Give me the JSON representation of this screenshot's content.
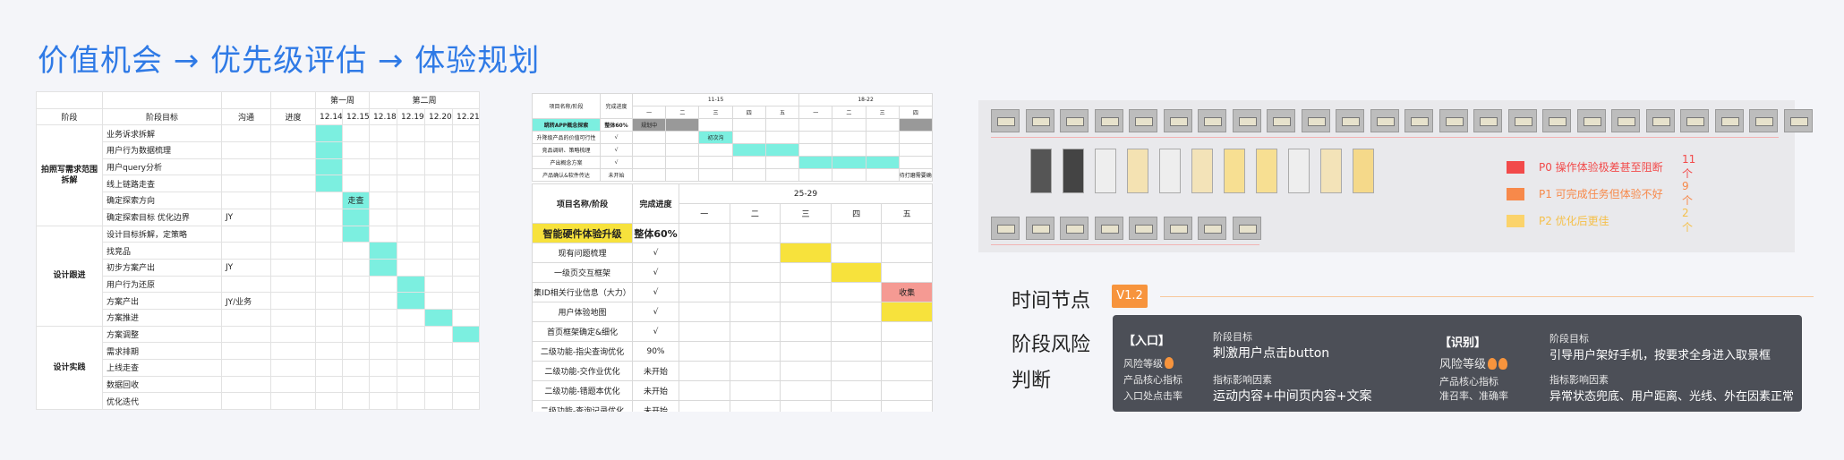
{
  "title": "价值机会 → 优先级评估 → 体验规划",
  "gantt1": {
    "week1": "第一周",
    "week2": "第二周",
    "headers": [
      "阶段",
      "阶段目标",
      "沟通",
      "进度",
      "12.14",
      "12.15",
      "12.18",
      "12.19",
      "12.20",
      "12.21"
    ],
    "phases": [
      "拍照写需求范围拆解",
      "设计跟进",
      "设计实践"
    ],
    "rows": [
      {
        "goal": "业务诉求拆解",
        "comm": ""
      },
      {
        "goal": "用户行为数据梳理",
        "comm": ""
      },
      {
        "goal": "用户query分析",
        "comm": ""
      },
      {
        "goal": "线上链路走查",
        "comm": ""
      },
      {
        "goal": "确定探索方向",
        "comm": ""
      },
      {
        "goal": "确定探索目标 优化边界",
        "comm": "JY"
      },
      {
        "goal": "设计目标拆解，定策略",
        "comm": ""
      },
      {
        "goal": "找竞品",
        "comm": ""
      },
      {
        "goal": "初步方案产出",
        "comm": "JY"
      },
      {
        "goal": "用户行为还原",
        "comm": ""
      },
      {
        "goal": "方案产出",
        "comm": "JY/业务"
      },
      {
        "goal": "方案推进",
        "comm": ""
      },
      {
        "goal": "方案调整",
        "comm": ""
      },
      {
        "goal": "需求排期",
        "comm": ""
      },
      {
        "goal": "上线走查",
        "comm": ""
      },
      {
        "goal": "数据回收",
        "comm": ""
      },
      {
        "goal": "优化迭代",
        "comm": ""
      }
    ],
    "walk_label": "走查"
  },
  "gantt2": {
    "mini": {
      "h1": "项目名称/阶段",
      "h2": "完成进度",
      "w1": "11-15",
      "w2": "18-22",
      "days": [
        "一",
        "二",
        "三",
        "四",
        "五",
        "一",
        "二",
        "三",
        "四"
      ],
      "rows": [
        {
          "name": "跳转APP概念探索",
          "prog": "整体60%"
        },
        {
          "name": "升降级产品的价值可行性",
          "prog": "√"
        },
        {
          "name": "竞品调研、策略梳理",
          "prog": "√"
        },
        {
          "name": "产出概念方案",
          "prog": "√"
        },
        {
          "name": "产品确认&软件传达",
          "prog": "未开始"
        }
      ],
      "tag1": "规划中",
      "tag2": "初次沟",
      "note": "待打磨需要确认"
    },
    "main": {
      "h1": "项目名称/阶段",
      "h2": "完成进度",
      "week": "25-29",
      "days": [
        "一",
        "二",
        "三",
        "四",
        "五"
      ],
      "rows": [
        {
          "name": "智能硬件体验升级",
          "prog": "整体60%"
        },
        {
          "name": "现有问题梳理",
          "prog": "√"
        },
        {
          "name": "一级页交互框架",
          "prog": "√"
        },
        {
          "name": "集ID相关行业信息（大力）",
          "prog": "√"
        },
        {
          "name": "用户体验地图",
          "prog": "√"
        },
        {
          "name": "首页框架确定&细化",
          "prog": "√"
        },
        {
          "name": "二级功能-指尖查询优化",
          "prog": "90%"
        },
        {
          "name": "二级功能-交作业优化",
          "prog": "未开始"
        },
        {
          "name": "二级功能-错题本优化",
          "prog": "未开始"
        },
        {
          "name": "二级功能-查询记录优化",
          "prog": "未开始"
        }
      ],
      "collect": "收集"
    }
  },
  "legend": [
    {
      "label": "P0 操作体验极差甚至阻断",
      "count": "11个",
      "color": "#f24a4a"
    },
    {
      "label": "P1 可完成任务但体验不好",
      "count": "9个",
      "color": "#f7894a"
    },
    {
      "label": "P2 优化后更佳",
      "count": "2个",
      "color": "#fbd36b"
    }
  ],
  "timeline": {
    "label": "时间节点",
    "version": "V1.2"
  },
  "risk_label": [
    "阶段风险",
    "判断"
  ],
  "cards": [
    {
      "head": "【入口】",
      "risk": "风险等级",
      "metric_k": "产品核心指标",
      "metric_v": "入口处点击率",
      "goal_k": "阶段目标",
      "goal_v": "刺激用户点击button",
      "factor_k": "指标影响因素",
      "factor_v": "运动内容+中间页内容+文案"
    },
    {
      "head": "【识别】",
      "risk": "风险等级",
      "metric_k": "产品核心指标",
      "metric_v": "准召率、准确率",
      "goal_k": "阶段目标",
      "goal_v": "引导用户架好手机，按要求全身进入取景框",
      "factor_k": "指标影响因素",
      "factor_v": "异常状态兜底、用户距离、光线、外在因素正常"
    }
  ]
}
